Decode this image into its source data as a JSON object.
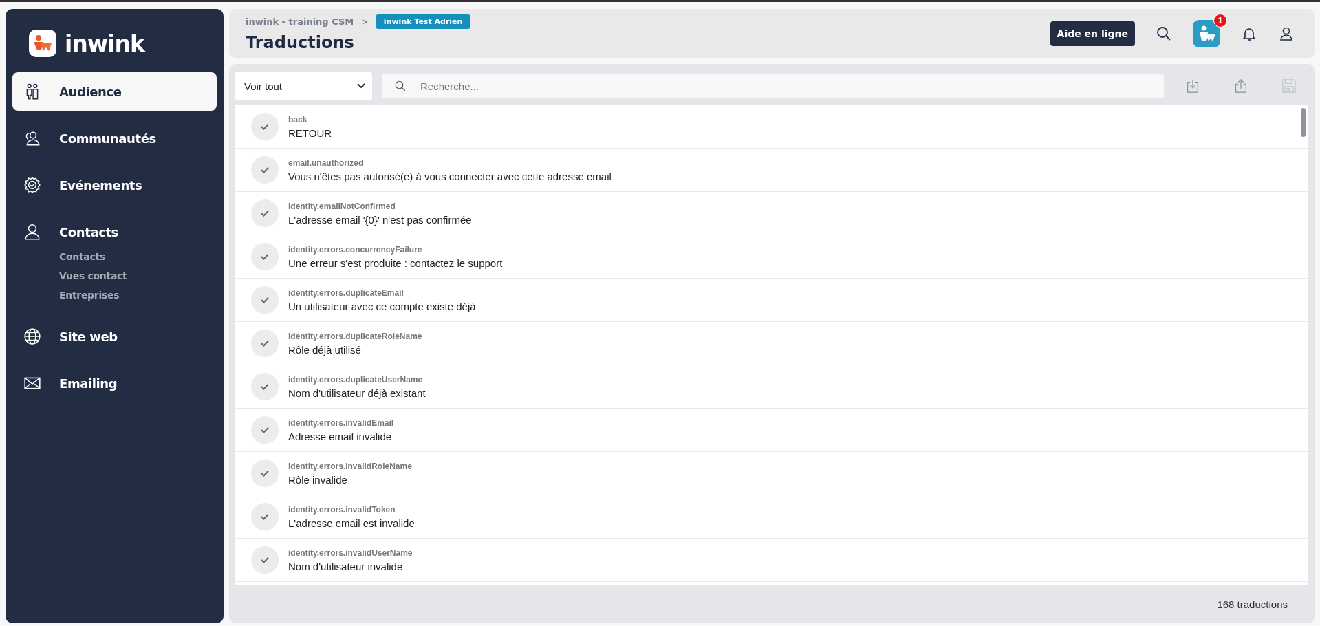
{
  "sidebar": {
    "logo": "inwink",
    "items": [
      {
        "label": "Audience",
        "selected": true
      },
      {
        "label": "Communautés",
        "selected": false
      },
      {
        "label": "Evénements",
        "selected": false
      },
      {
        "label": "Contacts",
        "selected": false,
        "children": [
          {
            "label": "Contacts"
          },
          {
            "label": "Vues contact"
          },
          {
            "label": "Entreprises"
          }
        ]
      },
      {
        "label": "Site web",
        "selected": false
      },
      {
        "label": "Emailing",
        "selected": false
      }
    ]
  },
  "header": {
    "breadcrumb": "inwink - training CSM",
    "breadcrumb_separator": ">",
    "event_badge": "inwink Test Adrien",
    "title": "Traductions",
    "help_button": "Aide en ligne",
    "notification_count": "1"
  },
  "toolbar": {
    "filter": "Voir tout",
    "search": {
      "placeholder": "Recherche..."
    }
  },
  "translations": [
    {
      "key": "back",
      "value": "RETOUR"
    },
    {
      "key": "email.unauthorized",
      "value": "Vous n'êtes pas autorisé(e) à vous connecter avec cette adresse email"
    },
    {
      "key": "identity.emailNotConfirmed",
      "value": "L'adresse email '{0}' n'est pas confirmée"
    },
    {
      "key": "identity.errors.concurrencyFailure",
      "value": "Une erreur s'est produite : contactez le support"
    },
    {
      "key": "identity.errors.duplicateEmail",
      "value": "Un utilisateur avec ce compte existe déjà"
    },
    {
      "key": "identity.errors.duplicateRoleName",
      "value": "Rôle déjà utilisé"
    },
    {
      "key": "identity.errors.duplicateUserName",
      "value": "Nom d'utilisateur déjà existant"
    },
    {
      "key": "identity.errors.invalidEmail",
      "value": "Adresse email invalide"
    },
    {
      "key": "identity.errors.invalidRoleName",
      "value": "Rôle invalide"
    },
    {
      "key": "identity.errors.invalidToken",
      "value": "L'adresse email est invalide"
    },
    {
      "key": "identity.errors.invalidUserName",
      "value": "Nom d'utilisateur invalide"
    }
  ],
  "footer": {
    "count": "168 traductions"
  }
}
